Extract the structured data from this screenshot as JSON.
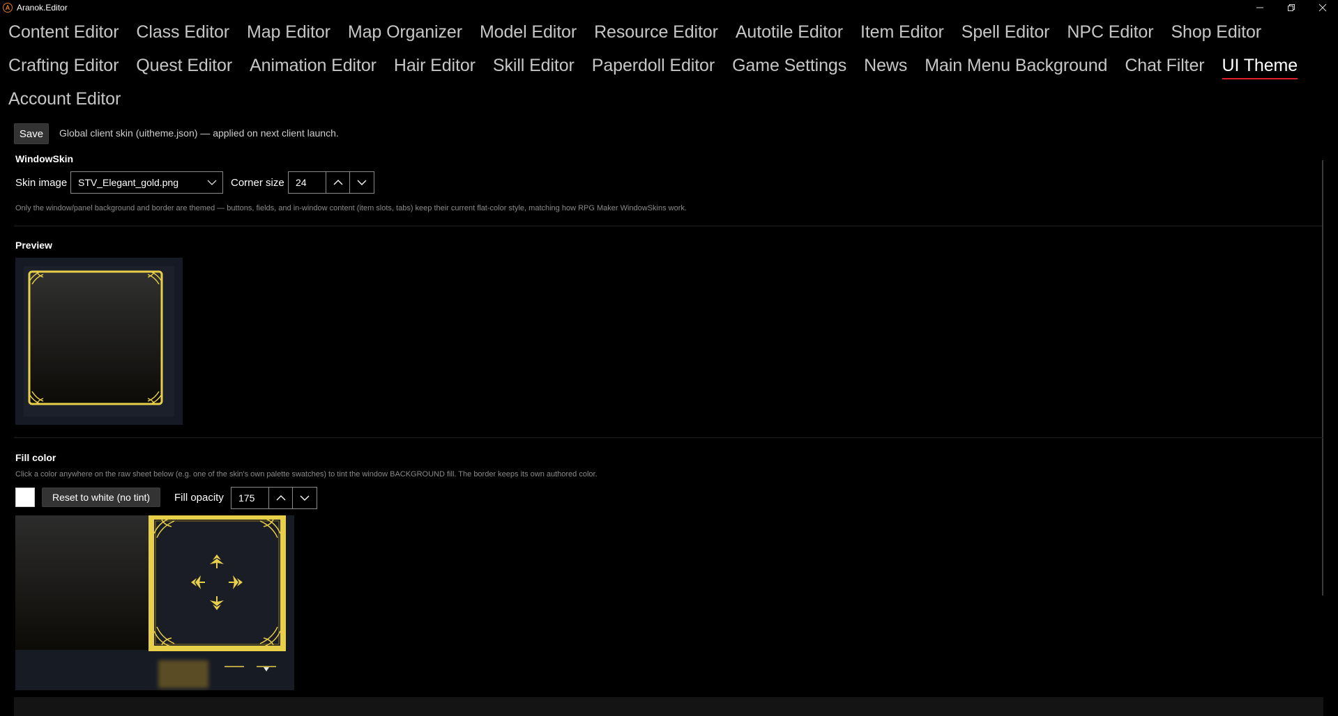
{
  "window": {
    "title": "Aranok.Editor",
    "controls": [
      "minimize-icon",
      "maximize-icon",
      "close-icon"
    ]
  },
  "tabs": {
    "row1": [
      "Content Editor",
      "Class Editor",
      "Map Editor",
      "Map Organizer",
      "Model Editor",
      "Resource Editor",
      "Autotile Editor",
      "Item Editor",
      "Spell Editor",
      "NPC Editor",
      "Shop Editor"
    ],
    "row2": [
      "Crafting Editor",
      "Quest Editor",
      "Animation Editor",
      "Hair Editor",
      "Skill Editor",
      "Paperdoll Editor",
      "Game Settings",
      "News",
      "Main Menu Background",
      "Chat Filter",
      "UI Theme"
    ],
    "row3": [
      "Account Editor"
    ],
    "active": "UI Theme",
    "active_underline_color": "#e0202a"
  },
  "toolbar": {
    "save_label": "Save",
    "note": "Global client skin (uitheme.json) — applied on next client launch."
  },
  "windowskin": {
    "title": "WindowSkin",
    "skin_image_label": "Skin image",
    "skin_image_value": "STV_Elegant_gold.png",
    "corner_size_label": "Corner size",
    "corner_size_value": "24",
    "hint": "Only the window/panel background and border are themed — buttons, fields, and in-window content (item slots, tabs) keep their current flat-color style, matching how RPG Maker WindowSkins work."
  },
  "preview": {
    "title": "Preview",
    "border_color": "#e8cf4a"
  },
  "fill": {
    "title": "Fill color",
    "hint": "Click a color anywhere on the raw sheet below (e.g. one of the skin's own palette swatches) to tint the window BACKGROUND fill. The border keeps its own authored color.",
    "swatch_color": "#ffffff",
    "reset_label": "Reset to white (no tint)",
    "opacity_label": "Fill opacity",
    "opacity_value": "175"
  }
}
